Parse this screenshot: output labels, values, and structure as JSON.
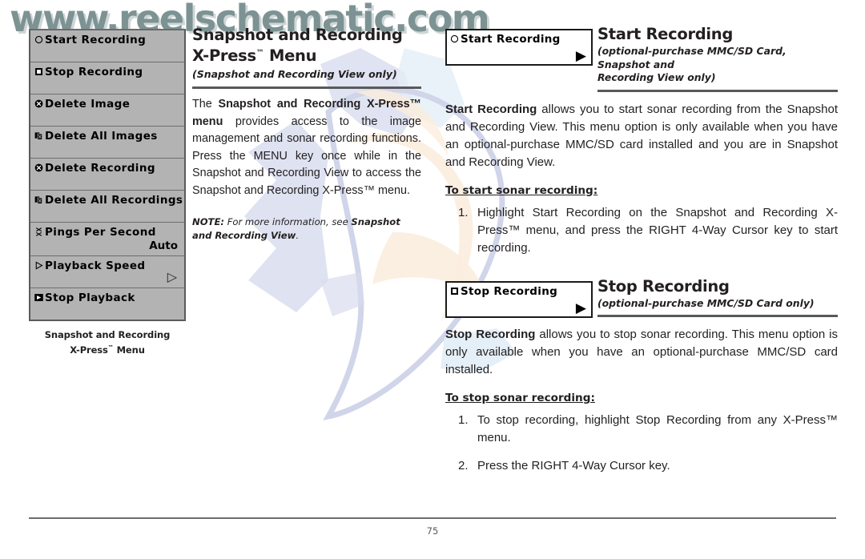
{
  "watermark": {
    "url_text": "www.reelschematic.com",
    "color": "#7d9293",
    "fish_graphic": "dolphin-fish-watermark"
  },
  "left_column": {
    "menu_title_caption_line1": "Snapshot and Recording",
    "menu_title_caption_line2": "X-Press™ Menu",
    "menu_items": [
      {
        "icon": "circle-outline-icon",
        "label": "Start Recording",
        "value": "",
        "sub_arrow": ""
      },
      {
        "icon": "stop-square-icon",
        "label": "Stop Recording",
        "value": "",
        "sub_arrow": ""
      },
      {
        "icon": "delete-x-icon",
        "label": "Delete Image",
        "value": "",
        "sub_arrow": ""
      },
      {
        "icon": "delete-all-pages-icon",
        "label": "Delete All Images",
        "value": "",
        "sub_arrow": ""
      },
      {
        "icon": "delete-x-icon",
        "label": "Delete Recording",
        "value": "",
        "sub_arrow": ""
      },
      {
        "icon": "delete-all-pages-icon",
        "label": "Delete All Recordings",
        "value": "",
        "sub_arrow": ""
      },
      {
        "icon": "pings-per-second-icon",
        "label": "Pings Per Second",
        "value": "Auto",
        "sub_arrow": ""
      },
      {
        "icon": "play-outline-icon",
        "label": "Playback Speed",
        "value": "",
        "sub_arrow": "▷"
      },
      {
        "icon": "play-filled-box-icon",
        "label": "Stop Playback",
        "value": "",
        "sub_arrow": ""
      }
    ]
  },
  "middle_column": {
    "title_line1": "Snapshot and Recording",
    "title_line2_pre": "X-Press",
    "title_line2_tm": "™",
    "title_line2_post": " Menu",
    "subtitle": "(Snapshot and Recording View only)",
    "paragraph_parts": [
      {
        "text": "The ",
        "bold": false
      },
      {
        "text": "Snapshot and Recording X-Press™ menu",
        "bold": true
      },
      {
        "text": " provides access to the image management and sonar recording functions. Press the MENU key once while in the Snapshot and Recording View to access the Snapshot and Recording X-Press™ menu.",
        "bold": false
      }
    ],
    "note_label": "NOTE:",
    "note_text": " For more information, see ",
    "note_ref": "Snapshot and Recording View",
    "note_end": "."
  },
  "right_column": {
    "sections": [
      {
        "chip_icon": "circle-outline-icon",
        "chip_label": "Start Recording",
        "chip_arrow": "▶",
        "heading": "Start Recording",
        "sub_line1": "(optional-purchase MMC/SD Card, Snapshot and",
        "sub_line2": "Recording View only)",
        "body_bold": "Start Recording",
        "body_rest": " allows you to start sonar recording from the Snapshot and Recording View. This menu option is only available when you have an optional-purchase MMC/SD card installed and you are in Snapshot and Recording View.",
        "subhead": "To start sonar recording:",
        "steps": [
          {
            "num": "1.",
            "text": "Highlight Start Recording on the Snapshot and Recording X-Press™ menu, and press the RIGHT 4-Way Cursor key to start recording."
          }
        ]
      },
      {
        "chip_icon": "stop-square-icon",
        "chip_label": "Stop Recording",
        "chip_arrow": "▶",
        "heading": "Stop Recording",
        "sub_line1": "(optional-purchase MMC/SD Card only)",
        "sub_line2": "",
        "body_bold": "Stop Recording",
        "body_rest": " allows you to stop sonar recording. This menu option is only available when you have an optional-purchase MMC/SD card installed.",
        "subhead": "To stop sonar recording:",
        "steps": [
          {
            "num": "1.",
            "text": "To stop recording, highlight Stop Recording from any X-Press™ menu."
          },
          {
            "num": "2.",
            "text": "Press the RIGHT 4-Way Cursor key."
          }
        ]
      }
    ]
  },
  "footer": {
    "page_number": "75"
  }
}
